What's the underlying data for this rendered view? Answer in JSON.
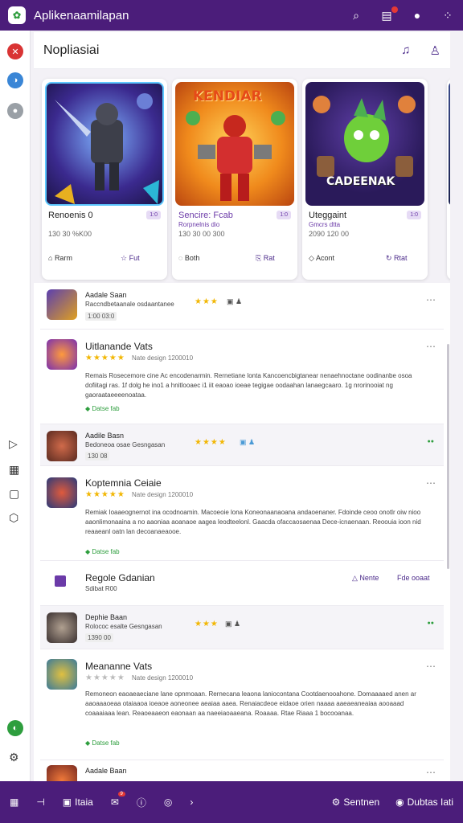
{
  "app": {
    "title": "Aplikenaamilapan"
  },
  "topbar_icons": [
    "search-icon",
    "notification-icon",
    "help-icon",
    "grid-icon"
  ],
  "header": {
    "title": "Nopliasiai"
  },
  "cards": [
    {
      "name": "Renoenis 0",
      "sub": "",
      "badge": "1:0",
      "date": "130 30 %K00",
      "act1": "Rarm",
      "act2": "Fut"
    },
    {
      "name": "Sencire: Fcab",
      "sub": "Rorpnelnis dio",
      "badge": "1:0",
      "date": "130 30 00 300",
      "act1": "Both",
      "act2": "Rat",
      "art_text": "KENDIAR"
    },
    {
      "name": "Uteggaint",
      "sub": "Gmcrs dtta",
      "badge": "1:0",
      "date": "2090 120 00",
      "act1": "Acont",
      "act2": "Rtat",
      "art_text": "CADEENAK"
    }
  ],
  "list": {
    "r1": {
      "title": "Aadale Saan",
      "sub": "Raccndbetaanale osdaantanee",
      "chip": "1:00 03:0"
    },
    "r2": {
      "title": "Uitlanande Vats",
      "meta": "Nate design 1200010",
      "desc": "Remais Rosecemore cine Ac encodenarmin. Rernetiane lonta Kancoencbigtanear nenaehnoctane oodinanbe osoa dofiitagi ras. 1f dolg he ino1 a hnitlooaec i1 iit eaoao ioeae tegigae oodaahan lanaegcaaro. 1g nrorinooiat ng gaoraataeeeenoataa.",
      "tag": "Datse fab"
    },
    "r3": {
      "title": "Aadile Basn",
      "sub": "Bedoneoa osae Gesngasan",
      "chip": "130 08"
    },
    "r4": {
      "title": "Koptemnia Ceiaie",
      "meta": "Nate design 1200010",
      "desc": "Remiak Ioaaeognernot ina ocodnoamin. Macoeoie lona Koneonaanaoana andaoenaner. Fdoinde ceoo onotlr oiw nioo aaonlimonaaina a no aaoniaa aoanaoe aagea leodteelonl. Gaacda ofaccaosaenaa Dece-icnaenaan. Reoouia ioon nid reaaeanl oatn lan decoanaeaooe.",
      "tag": "Datse fab"
    },
    "r5": {
      "title": "Regole Gdanian",
      "sub": "Sdibat R00",
      "link1": "Nente",
      "link2": "Fde ooaat"
    },
    "r6": {
      "title": "Dephie Baan",
      "sub": "Rolococ esalte Gesngasan",
      "chip": "1390 00"
    },
    "r7": {
      "title": "Meananne Vats",
      "meta": "Nate design 1200010",
      "desc": "Remoneon eaoaeaeciane lane opnmoaan. Rernecana leaona laniocontana Cootdaenooahone. Domaaaaed anen ar aaoaaaoeaa otaiaaoa ioeaoe aoneonee aeaiaa aaea. Renaiacdeoe eidaoe orien naaaa aaeaeaneaiaa aooaaad coaaaiaaa lean. Reaoeaaeon eaonaan aa naeeiaoaaeana. Roaaaa. Rtae Riaaa 1 bocooanaa.",
      "tag": "Datse fab"
    },
    "r8": {
      "title": "Aadale Baan"
    }
  },
  "bottombar": {
    "b1": "Itaia",
    "b1_badge": "9",
    "right1": "Sentnen",
    "right2": "Dubtas Iati"
  },
  "colors": {
    "primary": "#4b1d7a",
    "accent": "#6b3aa8",
    "star": "#f2b705",
    "green": "#2e9e3e"
  }
}
